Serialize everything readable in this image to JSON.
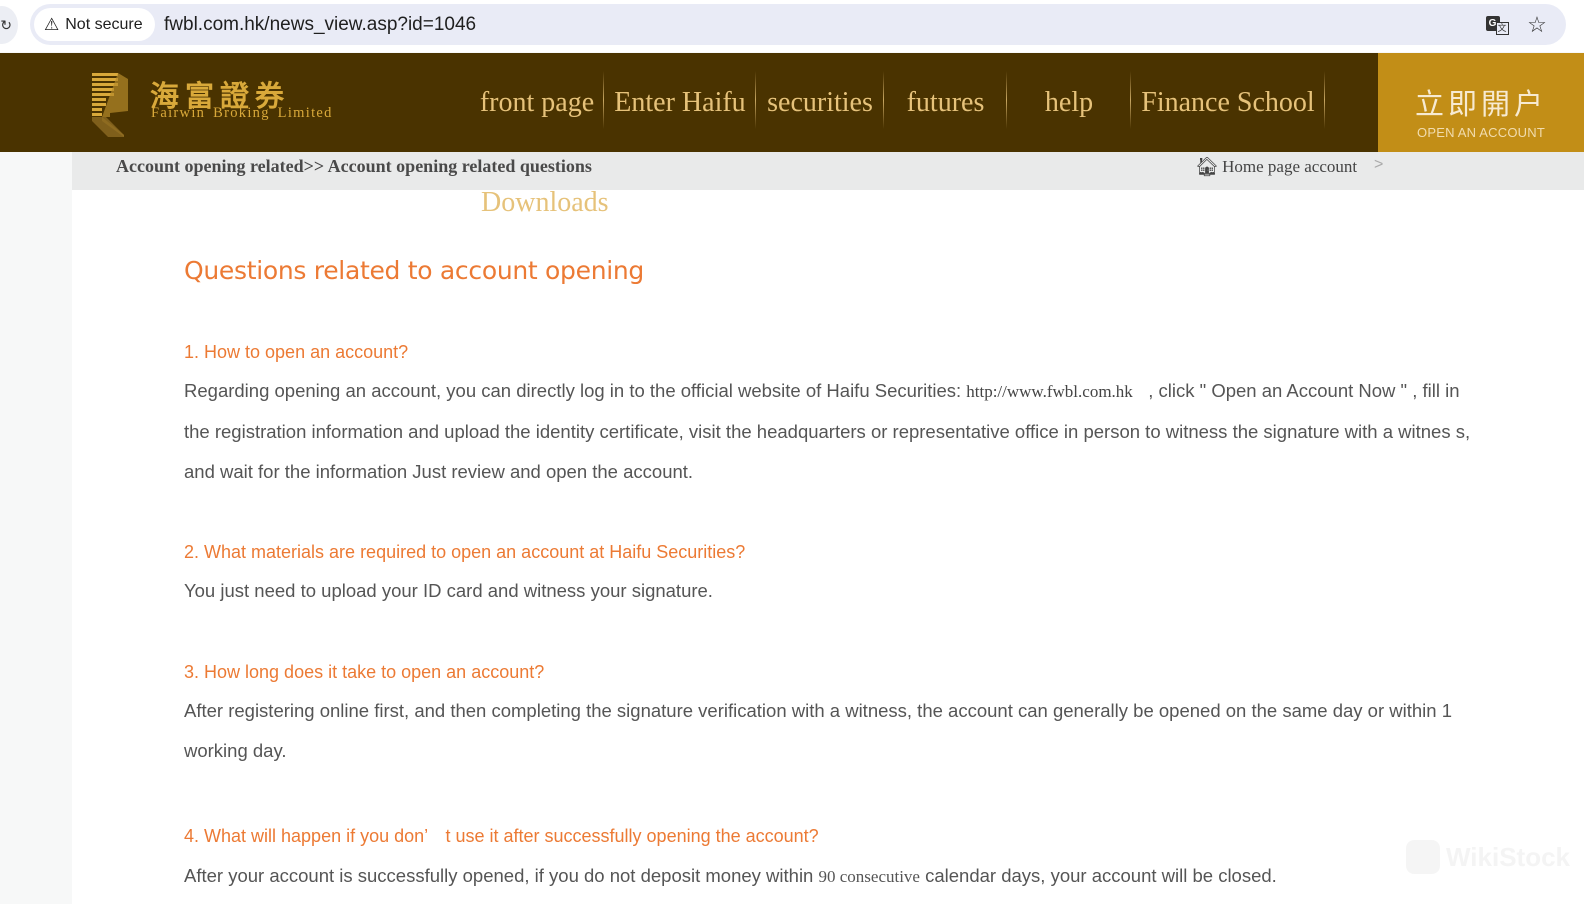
{
  "browser": {
    "security_label": "Not secure",
    "url": "fwbl.com.hk/news_view.asp?id=1046",
    "icons": [
      "reload-icon",
      "warning-icon",
      "translate-icon",
      "star-icon"
    ]
  },
  "header": {
    "logo_cn": "海富證券",
    "logo_en": "Fairwin Broking Limited",
    "nav": [
      {
        "label": "front page"
      },
      {
        "label": "Enter Haifu"
      },
      {
        "label": "securities"
      },
      {
        "label": "futures"
      },
      {
        "label": "help"
      },
      {
        "label": "Finance School"
      }
    ],
    "cta": {
      "label_cn": "立即開户",
      "label_en": "OPEN AN ACCOUNT"
    },
    "colors": {
      "header_bg": "#4a3300",
      "nav_text": "#e6c27a",
      "cta_bg": "#c28e17",
      "accent_orange": "#ec7a34"
    }
  },
  "breadcrumb": {
    "path": "Account opening related>> Account opening related questions",
    "home_label": "Home page account",
    "arrow": ">"
  },
  "submenu": {
    "downloads_label": "Downloads"
  },
  "article": {
    "title": "Questions related to account opening",
    "qas": [
      {
        "question": "1. How to open an account?",
        "answer_pre": "Regarding opening an account, you can directly log in to the official website of Haifu Securities: ",
        "answer_link": "http://www.fwbl.com.hk",
        "answer_post": "   , click \" Open an Account Now \" , fill in the registration information and upload the identity certificate, visit the headquarters or representative office in person to witness the signature with a witnes s, and wait for the information Just review and open the account."
      },
      {
        "question": "2. What materials are required to open an account at Haifu Securities?",
        "answer": "You just need to upload your ID card and witness your signature."
      },
      {
        "question": "3. How long does it take to open an account?",
        "answer": "After registering online first, and then completing the signature verification with a witness, the account can generally be opened on the same day or within 1 working day."
      },
      {
        "question": "4. What will happen if you don’　t use it after successfully opening the account?",
        "answer_pre": "After your account is successfully opened, if you do not deposit money within ",
        "answer_serif": "90 consecutive",
        "answer_post": " calendar days, your account will be closed."
      }
    ]
  },
  "watermark": {
    "text": "WikiStock"
  }
}
